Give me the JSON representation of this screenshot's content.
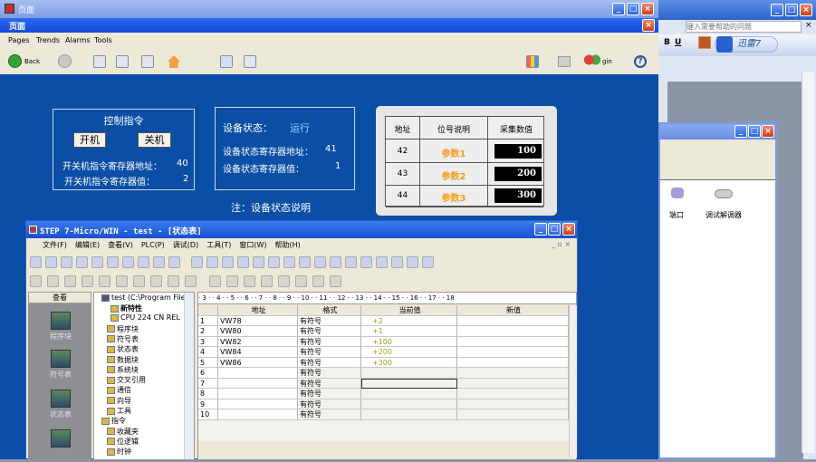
{
  "hmi": {
    "outer_title": "页面",
    "inner_title": "页面",
    "menu": [
      "Pages",
      "Trends",
      "Alarms",
      "Tools"
    ],
    "toolbar": {
      "back_label": "Back",
      "login_label": "gin"
    },
    "control": {
      "title": "控制指令",
      "start_button": "开机",
      "stop_button": "关机",
      "addr_label": "开关机指令寄存器地址：",
      "addr_value": "40",
      "val_label": "开关机指令寄存器值：",
      "val_value": "2"
    },
    "status": {
      "state_label": "设备状态：",
      "state_value": "运行",
      "addr_label": "设备状态寄存器地址：",
      "addr_value": "41",
      "val_label": "设备状态寄存器值：",
      "val_value": "1"
    },
    "note": "注：设备状态说明",
    "table": {
      "headers": [
        "地址",
        "位号说明",
        "采集数值"
      ],
      "rows": [
        {
          "addr": "42",
          "name": "参数1",
          "value": "100"
        },
        {
          "addr": "43",
          "name": "参数2",
          "value": "200"
        },
        {
          "addr": "44",
          "name": "参数3",
          "value": "300"
        }
      ]
    },
    "colors": {
      "canvas": "#0b4ea6",
      "param_text": "#f0a020"
    }
  },
  "step7": {
    "title": "STEP 7-Micro/WIN - test - [状态表]",
    "menu": [
      "文件(F)",
      "编辑(E)",
      "查看(V)",
      "PLC(P)",
      "调试(D)",
      "工具(T)",
      "窗口(W)",
      "帮助(H)"
    ],
    "sidebar": {
      "header": "查看",
      "items": [
        "程序块",
        "符号表",
        "状态表"
      ]
    },
    "tree": {
      "root": "test (C:\\Program File",
      "items": [
        "新特性",
        "CPU 224 CN REL",
        "程序块",
        "符号表",
        "状态表",
        "数据块",
        "系统块",
        "交叉引用",
        "通信",
        "向导",
        "工具",
        "指令",
        "收藏夹",
        "位逻辑",
        "时钟"
      ]
    },
    "ruler": "· 3 · · 4 · · 5 · · 6 · · 7 · · 8 · · 9 · · 10 · · 11 · · 12 · · 13 · · 14 · · 15 · · 16 · · 17 · · 18",
    "grid": {
      "headers": [
        "地址",
        "格式",
        "当前值",
        "新值"
      ],
      "rows": [
        {
          "n": "1",
          "addr": "VW78",
          "fmt": "有符号",
          "cur": "+2"
        },
        {
          "n": "2",
          "addr": "VW80",
          "fmt": "有符号",
          "cur": "+1"
        },
        {
          "n": "3",
          "addr": "VW82",
          "fmt": "有符号",
          "cur": "+100"
        },
        {
          "n": "4",
          "addr": "VW84",
          "fmt": "有符号",
          "cur": "+200"
        },
        {
          "n": "5",
          "addr": "VW86",
          "fmt": "有符号",
          "cur": "+300"
        },
        {
          "n": "6",
          "addr": "",
          "fmt": "有符号",
          "cur": ""
        },
        {
          "n": "7",
          "addr": "",
          "fmt": "有符号",
          "cur": ""
        },
        {
          "n": "8",
          "addr": "",
          "fmt": "有符号",
          "cur": ""
        },
        {
          "n": "9",
          "addr": "",
          "fmt": "有符号",
          "cur": ""
        },
        {
          "n": "10",
          "addr": "",
          "fmt": "有符号",
          "cur": ""
        }
      ]
    }
  },
  "background": {
    "help_placeholder": "键入需要帮助的问题",
    "xunlei": "迅雷7",
    "device_items": [
      "端口",
      "调试解调器"
    ]
  }
}
